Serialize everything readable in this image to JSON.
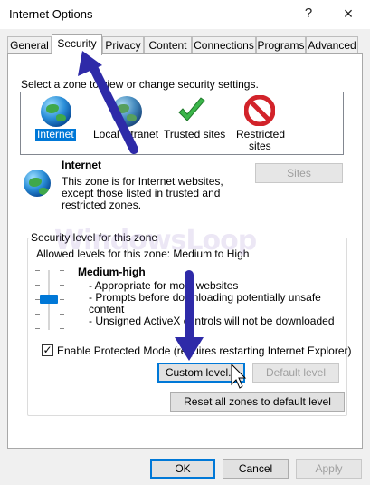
{
  "window": {
    "title": "Internet Options",
    "help_label": "?",
    "close_label": "×"
  },
  "tabs": [
    {
      "label": "General"
    },
    {
      "label": "Security"
    },
    {
      "label": "Privacy"
    },
    {
      "label": "Content"
    },
    {
      "label": "Connections"
    },
    {
      "label": "Programs"
    },
    {
      "label": "Advanced"
    }
  ],
  "security": {
    "zone_prompt": "Select a zone to view or change security settings.",
    "zones": [
      {
        "label": "Internet",
        "icon": "globe-icon",
        "selected": true
      },
      {
        "label": "Local intranet",
        "icon": "intranet-globe-icon",
        "selected": false
      },
      {
        "label": "Trusted sites",
        "icon": "checkmark-icon",
        "selected": false
      },
      {
        "label": "Restricted sites",
        "icon": "no-entry-icon",
        "selected": false
      }
    ],
    "restricted_line1": "Restricted",
    "restricted_line2": "sites",
    "selected_zone": {
      "name": "Internet",
      "description_lines": [
        "This zone is for Internet websites,",
        "except those listed in trusted and",
        "restricted zones."
      ]
    },
    "sites_button": "Sites",
    "level_group_title": "Security level for this zone",
    "allowed_levels": "Allowed levels for this zone: Medium to High",
    "level_name": "Medium-high",
    "level_bullets": [
      "- Appropriate for most websites",
      "- Prompts before downloading potentially unsafe",
      "content",
      "- Unsigned ActiveX controls will not be downloaded"
    ],
    "protected_mode_checked": true,
    "protected_mode_label": "Enable Protected Mode (requires restarting Internet Explorer)",
    "custom_level_button": "Custom level...",
    "default_level_button": "Default level",
    "reset_all_button": "Reset all zones to default level"
  },
  "footer": {
    "ok_button": "OK",
    "cancel_button": "Cancel",
    "apply_button": "Apply"
  },
  "watermark": "WindowsLoop",
  "colors": {
    "accent": "#0078d7",
    "annotation_arrow": "#2e2aa8"
  }
}
